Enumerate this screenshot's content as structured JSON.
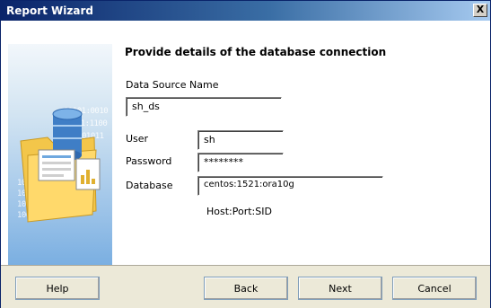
{
  "window": {
    "title": "Report Wizard",
    "close_symbol": "X"
  },
  "heading": "Provide details of the database connection",
  "side_panel": {
    "icon_names": [
      "database-icon",
      "folder-icon",
      "report-icon"
    ],
    "binary_lines": [
      "01101:0010",
      "1101:1100",
      "01011",
      "10101:0010",
      "10101:1101",
      "10011:0011",
      "10011:0011"
    ]
  },
  "form": {
    "datasource": {
      "label": "Data Source Name",
      "value": "sh_ds"
    },
    "user": {
      "label": "User",
      "value": "sh"
    },
    "password": {
      "label": "Password",
      "value": "********"
    },
    "database": {
      "label": "Database",
      "value": "centos:1521:ora10g"
    },
    "hint": "Host:Port:SID"
  },
  "buttons": {
    "help": "Help",
    "back": "Back",
    "next": "Next",
    "cancel": "Cancel"
  }
}
